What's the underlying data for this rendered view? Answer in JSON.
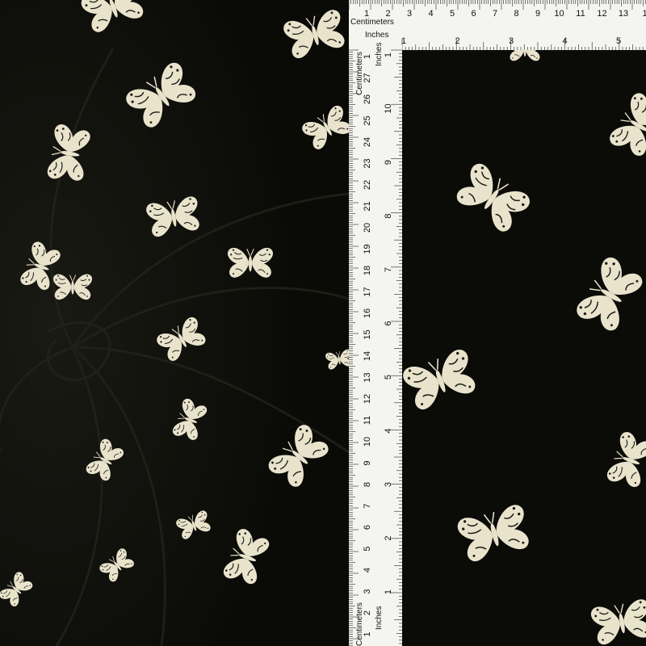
{
  "image": {
    "subject": "black fabric with cream butterfly print, with measuring rulers",
    "colors": {
      "fabric": "#0b0b08",
      "fabric_fold": "#151510",
      "print": "#e9e3cc",
      "ruler": "#f4f4f0",
      "ruler_ink": "#111111"
    }
  },
  "top_ruler": {
    "cm_label": "Centimeters",
    "inch_label": "Inches",
    "cm_numbers": [
      "1",
      "2",
      "3",
      "4",
      "5",
      "6",
      "7",
      "8",
      "9",
      "10",
      "11",
      "12",
      "13",
      "1"
    ],
    "inch_numbers": [
      "1",
      "2",
      "3",
      "4",
      "5"
    ]
  },
  "left_ruler": {
    "cm_label": "Centimeters",
    "inch_label": "Inches",
    "bottom_cm_label": "Centimeters",
    "bottom_inch_label": "Inches",
    "cm_numbers": [
      "1",
      "27",
      "26",
      "25",
      "24",
      "23",
      "22",
      "21",
      "20",
      "19",
      "18",
      "17",
      "16",
      "15",
      "14",
      "13",
      "12",
      "11",
      "10",
      "9",
      "8",
      "7",
      "6",
      "5",
      "4",
      "3",
      "2",
      "1",
      "1"
    ],
    "inch_numbers": [
      "1",
      "10",
      "9",
      "8",
      "7",
      "6",
      "5",
      "4",
      "3",
      "2",
      "1"
    ]
  }
}
